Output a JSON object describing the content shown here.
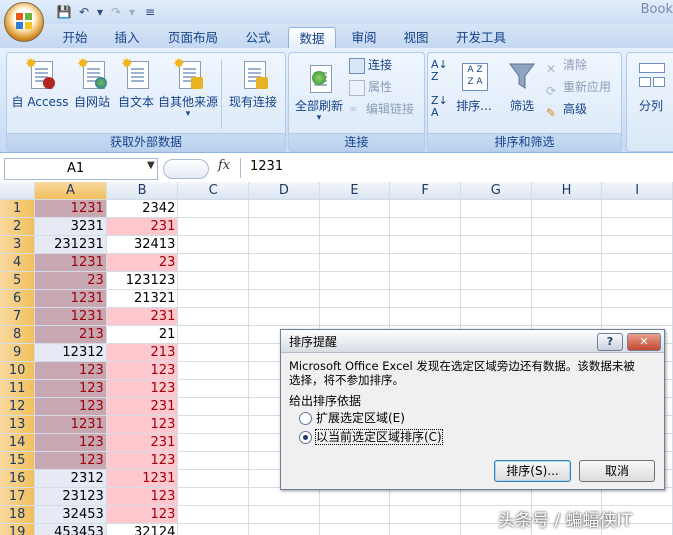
{
  "titlebar": {
    "book_text": "Book"
  },
  "tabs": [
    "开始",
    "插入",
    "页面布局",
    "公式",
    "数据",
    "审阅",
    "视图",
    "开发工具"
  ],
  "active_tab": "数据",
  "ribbon": {
    "external": {
      "label": "获取外部数据",
      "buttons": [
        "自 Access",
        "自网站",
        "自文本",
        "自其他来源",
        "现有连接"
      ]
    },
    "connections": {
      "label": "连接",
      "refresh": "全部刷新",
      "small": [
        "连接",
        "属性",
        "编辑链接"
      ]
    },
    "sortfilter": {
      "label": "排序和筛选",
      "sort": "排序...",
      "filter": "筛选",
      "small": [
        "清除",
        "重新应用",
        "高级"
      ],
      "az": "A Z",
      "za": "Z A"
    },
    "tools": {
      "split": "分列"
    }
  },
  "formulabar": {
    "namebox": "A1",
    "fx": "fx",
    "value": "1231"
  },
  "sheet": {
    "columns": [
      "A",
      "B",
      "C",
      "D",
      "E",
      "F",
      "G",
      "H",
      "I"
    ],
    "rows": [
      {
        "n": "1",
        "a": "1231",
        "b": "2342",
        "ha": true,
        "hb": false
      },
      {
        "n": "2",
        "a": "3231",
        "b": "231",
        "ha": false,
        "hb": true
      },
      {
        "n": "3",
        "a": "231231",
        "b": "32413",
        "ha": false,
        "hb": false
      },
      {
        "n": "4",
        "a": "1231",
        "b": "23",
        "ha": true,
        "hb": true
      },
      {
        "n": "5",
        "a": "23",
        "b": "123123",
        "ha": true,
        "hb": false
      },
      {
        "n": "6",
        "a": "1231",
        "b": "21321",
        "ha": true,
        "hb": false
      },
      {
        "n": "7",
        "a": "1231",
        "b": "231",
        "ha": true,
        "hb": true
      },
      {
        "n": "8",
        "a": "213",
        "b": "21",
        "ha": true,
        "hb": false
      },
      {
        "n": "9",
        "a": "12312",
        "b": "213",
        "ha": false,
        "hb": true
      },
      {
        "n": "10",
        "a": "123",
        "b": "123",
        "ha": true,
        "hb": true
      },
      {
        "n": "11",
        "a": "123",
        "b": "123",
        "ha": true,
        "hb": true
      },
      {
        "n": "12",
        "a": "123",
        "b": "231",
        "ha": true,
        "hb": true
      },
      {
        "n": "13",
        "a": "1231",
        "b": "123",
        "ha": true,
        "hb": true
      },
      {
        "n": "14",
        "a": "123",
        "b": "231",
        "ha": true,
        "hb": true
      },
      {
        "n": "15",
        "a": "123",
        "b": "123",
        "ha": true,
        "hb": true
      },
      {
        "n": "16",
        "a": "2312",
        "b": "1231",
        "ha": false,
        "hb": true
      },
      {
        "n": "17",
        "a": "23123",
        "b": "123",
        "ha": false,
        "hb": true
      },
      {
        "n": "18",
        "a": "32453",
        "b": "123",
        "ha": false,
        "hb": true
      },
      {
        "n": "19",
        "a": "453453",
        "b": "32124",
        "ha": false,
        "hb": false
      }
    ]
  },
  "dialog": {
    "title": "排序提醒",
    "help": "?",
    "close": "✕",
    "message_line1": "Microsoft Office Excel 发现在选定区域旁边还有数据。该数据未被",
    "message_line2": "选择，将不参加排序。",
    "section": "给出排序依据",
    "option_expand": "扩展选定区域(E)",
    "option_current": "以当前选定区域排序(C)",
    "sort_button": "排序(S)...",
    "cancel_button": "取消"
  },
  "watermark": "头条号 / 蝙蝠侠IT",
  "colors": {
    "highlight_a": "#c7a7b2",
    "highlight_b": "#ffc7ce",
    "dark_red_text": "#9c0006",
    "ribbon_text": "#15428b"
  }
}
